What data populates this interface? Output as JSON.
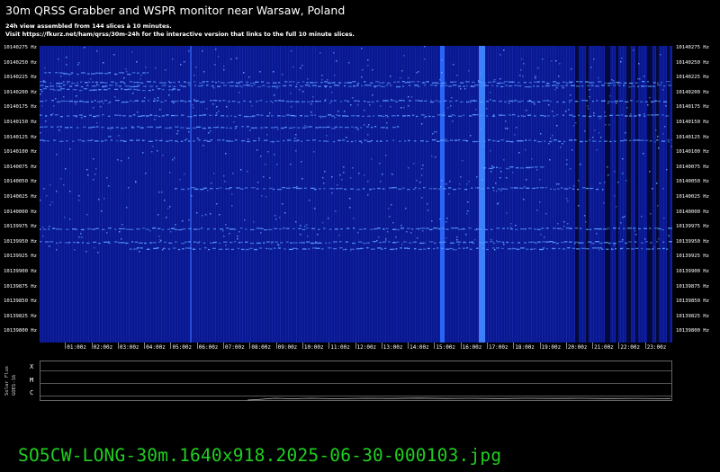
{
  "header": {
    "title": "30m QRSS Grabber and WSPR monitor near Warsaw, Poland",
    "line1": "24h view assembled from 144 slices à 10 minutes.",
    "line2": "Visit https://fkurz.net/ham/qrss/30m-24h for the interactive version that links to the full 10 minute slices."
  },
  "freq_axis": {
    "labels": [
      "10140275 Hz",
      "10140250 Hz",
      "10140225 Hz",
      "10140200 Hz",
      "10140175 Hz",
      "10140150 Hz",
      "10140125 Hz",
      "10140100 Hz",
      "10140075 Hz",
      "10140050 Hz",
      "10140025 Hz",
      "10140000 Hz",
      "10139975 Hz",
      "10139950 Hz",
      "10139925 Hz",
      "10139900 Hz",
      "10139875 Hz",
      "10139850 Hz",
      "10139825 Hz",
      "10139800 Hz"
    ]
  },
  "time_axis": {
    "labels": [
      "01:00z",
      "02:00z",
      "03:00z",
      "04:00z",
      "05:00z",
      "06:00z",
      "07:00z",
      "08:00z",
      "09:00z",
      "10:00z",
      "11:00z",
      "12:00z",
      "13:00z",
      "14:00z",
      "15:00z",
      "16:00z",
      "17:00z",
      "18:00z",
      "19:00z",
      "20:00z",
      "21:00z",
      "22:00z",
      "23:00z"
    ]
  },
  "solar_flux": {
    "label_top": "Solar Flux",
    "label_bottom": "GOES-16",
    "classes": [
      "X",
      "M",
      "C"
    ]
  },
  "colors": {
    "background": "#000000",
    "waterfall": "#0a1890",
    "signal": "#3a78ff",
    "filename": "#1fcf1f"
  },
  "footer": {
    "filename": "SO5CW-LONG-30m.1640x918.2025-06-30-000103.jpg"
  }
}
